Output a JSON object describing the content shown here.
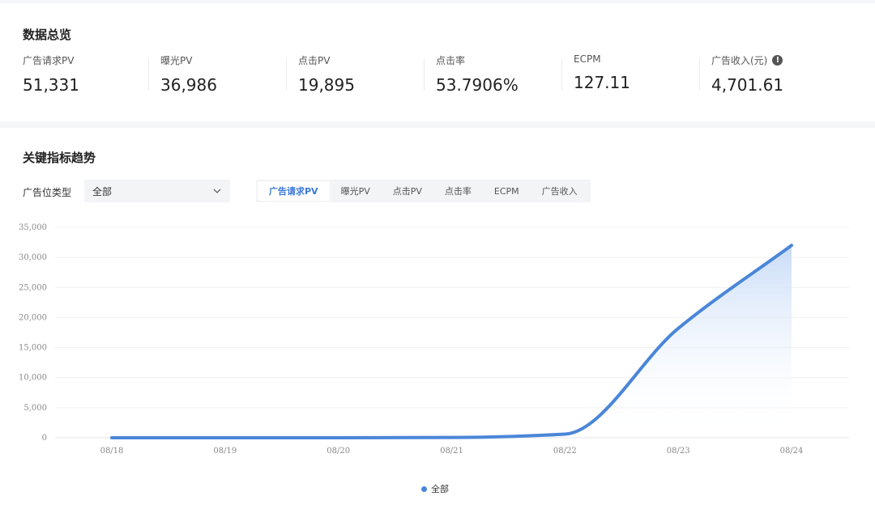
{
  "overview": {
    "title": "数据总览",
    "metrics": [
      {
        "label": "广告请求PV",
        "value": "51,331"
      },
      {
        "label": "曝光PV",
        "value": "36,986"
      },
      {
        "label": "点击PV",
        "value": "19,895"
      },
      {
        "label": "点击率",
        "value": "53.7906%"
      },
      {
        "label": "ECPM",
        "value": "127.11"
      },
      {
        "label": "广告收入(元)",
        "value": "4,701.61"
      }
    ],
    "info_glyph": "!"
  },
  "trend": {
    "title": "关键指标趋势",
    "filter_label": "广告位类型",
    "filter_value": "全部",
    "tabs": [
      "广告请求PV",
      "曝光PV",
      "点击PV",
      "点击率",
      "ECPM",
      "广告收入"
    ],
    "active_tab": "广告请求PV",
    "legend_label": "全部"
  },
  "colors": {
    "line": "#4a86d8",
    "active_tab": "#3b78d8"
  },
  "chart_data": {
    "type": "line",
    "x": [
      "08/18",
      "08/19",
      "08/20",
      "08/21",
      "08/22",
      "08/23",
      "08/24"
    ],
    "series": [
      {
        "name": "全部",
        "values": [
          0,
          0,
          0,
          50,
          600,
          18200,
          32000
        ]
      }
    ],
    "ylim": [
      0,
      35000
    ],
    "yticks": [
      0,
      5000,
      10000,
      15000,
      20000,
      25000,
      30000,
      35000
    ],
    "ytick_labels": [
      "0",
      "5,000",
      "10,000",
      "15,000",
      "20,000",
      "25,000",
      "30,000",
      "35,000"
    ],
    "grid": true,
    "legend_position": "bottom-center",
    "area_fill": true
  }
}
